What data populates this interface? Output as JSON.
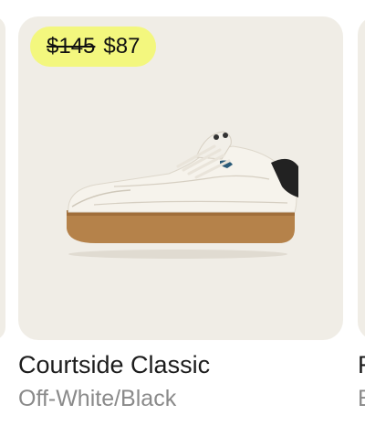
{
  "products": {
    "prev": {},
    "main": {
      "price_original": "$145",
      "price_sale": "$87",
      "name": "Courtside Classic",
      "colorway": "Off-White/Black",
      "image_icon": "sneaker-icon"
    },
    "next": {
      "name_partial": "F",
      "colorway_partial": "E"
    }
  },
  "colors": {
    "card_bg": "#f0ede6",
    "badge_bg": "#f3f77e",
    "title_text": "#1c1c1c",
    "subtitle_text": "#8a8a8a"
  }
}
